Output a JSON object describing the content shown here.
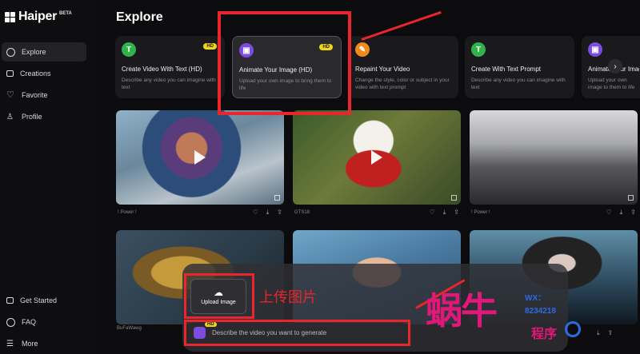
{
  "app": {
    "name": "Haiper",
    "badge": "BETA"
  },
  "sidebar": {
    "items": [
      {
        "label": "Explore",
        "icon": "compass-icon",
        "active": true
      },
      {
        "label": "Creations",
        "icon": "video-icon"
      },
      {
        "label": "Favorite",
        "icon": "heart-icon"
      },
      {
        "label": "Profile",
        "icon": "user-icon"
      }
    ],
    "bottom_items": [
      {
        "label": "Get Started",
        "icon": "book-icon"
      },
      {
        "label": "FAQ",
        "icon": "help-icon"
      },
      {
        "label": "More",
        "icon": "menu-icon"
      }
    ]
  },
  "main": {
    "title": "Explore",
    "cards": [
      {
        "title": "Create Video With Text (HD)",
        "desc": "Describe any video you can imagine with text",
        "hd": "HD",
        "icon_letter": "T",
        "color": "#2fb34a"
      },
      {
        "title": "Animate Your Image (HD)",
        "desc": "Upload your own image to bring them to life",
        "hd": "HD",
        "icon_letter": "▣",
        "color": "#7c4be0"
      },
      {
        "title": "Repaint Your Video",
        "desc": "Change the style, color or subject in your video with text prompt",
        "icon_letter": "✎",
        "color": "#f08a1c"
      },
      {
        "title": "Create With Text Prompt",
        "desc": "Describe any video you can imagine with text",
        "icon_letter": "T",
        "color": "#2fb34a"
      },
      {
        "title": "Animate Your Imag",
        "desc": "Upload your own image to them to life",
        "icon_letter": "▣",
        "color": "#7c4be0"
      }
    ],
    "tiles": [
      {
        "author": "! Power !"
      },
      {
        "author": "GTS18"
      },
      {
        "author": "! Power !"
      },
      {
        "author": "BuFaWawg"
      },
      {
        "author": ""
      },
      {
        "author": ""
      }
    ]
  },
  "overlay": {
    "upload_label": "Upload Image",
    "chinese_label": "上传图片",
    "prompt_placeholder": "Describe the video you want to generate",
    "prompt_hd": "HD",
    "watermark_text": "蜗牛",
    "watermark_wx": "WX：",
    "watermark_num": "8234218",
    "watermark_tail": "程序"
  },
  "colors": {
    "accent_red": "#e8262b",
    "hd_yellow": "#f1d51a",
    "purple": "#7c4be0"
  }
}
